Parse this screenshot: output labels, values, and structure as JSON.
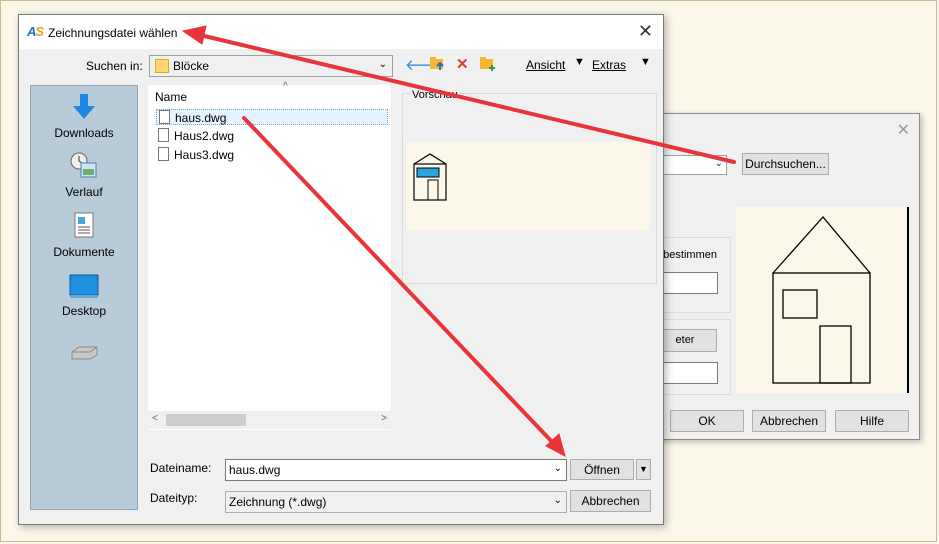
{
  "background_dialog": {
    "browse_button": "Durchsuchen...",
    "group_label_partial": "n bestimmen",
    "button_partial": "eter",
    "ok_button": "OK",
    "cancel_button": "Abbrechen",
    "help_button": "Hilfe"
  },
  "main_dialog": {
    "title": "Zeichnungsdatei wählen",
    "look_in_label": "Suchen in:",
    "look_in_value": "Blöcke",
    "toolbar": {
      "view_label": "Ansicht",
      "tools_label": "Extras"
    },
    "places": [
      {
        "label": "Downloads",
        "icon": "download-icon"
      },
      {
        "label": "Verlauf",
        "icon": "history-icon"
      },
      {
        "label": "Dokumente",
        "icon": "documents-icon"
      },
      {
        "label": "Desktop",
        "icon": "desktop-icon"
      },
      {
        "label": "",
        "icon": "drive-icon"
      }
    ],
    "file_list": {
      "column_header": "Name",
      "files": [
        "haus.dwg",
        "Haus2.dwg",
        "Haus3.dwg"
      ],
      "selected_index": 0
    },
    "preview_label": "Vorschau",
    "file_name_label": "Dateiname:",
    "file_name_value": "haus.dwg",
    "file_type_label": "Dateityp:",
    "file_type_value": "Zeichnung (*.dwg)",
    "open_button": "Öffnen",
    "cancel_button": "Abbrechen"
  },
  "colors": {
    "arrow": "#e8343a",
    "places_bar": "#b8cbd8",
    "preview_bg": "#fbf8ea"
  }
}
